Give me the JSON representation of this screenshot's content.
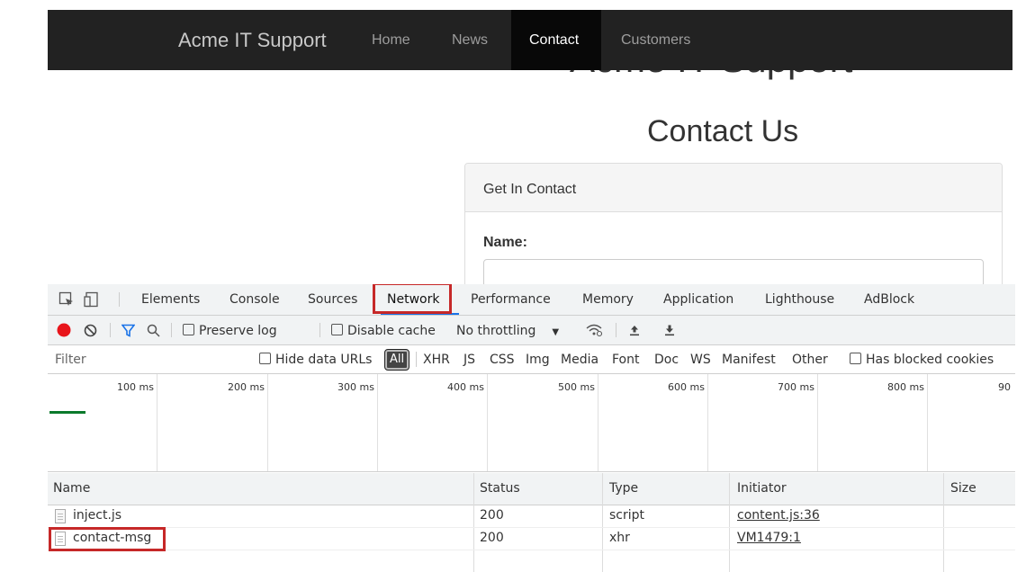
{
  "page": {
    "brand": "Acme IT Support",
    "nav": [
      {
        "label": "Home"
      },
      {
        "label": "News"
      },
      {
        "label": "Contact"
      },
      {
        "label": "Customers"
      }
    ],
    "hero_title": "Acme IT Support",
    "contact_title": "Contact Us",
    "panel_heading": "Get In Contact",
    "name_label": "Name:"
  },
  "devtools": {
    "tabs": [
      "Elements",
      "Console",
      "Sources",
      "Network",
      "Performance",
      "Memory",
      "Application",
      "Lighthouse",
      "AdBlock"
    ],
    "active_tab": "Network",
    "toolbar": {
      "preserve_log": "Preserve log",
      "disable_cache": "Disable cache",
      "throttling": "No throttling"
    },
    "filter": {
      "placeholder": "Filter",
      "hide_data_urls": "Hide data URLs",
      "all": "All",
      "types": [
        "XHR",
        "JS",
        "CSS",
        "Img",
        "Media",
        "Font",
        "Doc",
        "WS",
        "Manifest",
        "Other"
      ],
      "has_blocked_cookies": "Has blocked cookies"
    },
    "timeline_ticks": [
      "100 ms",
      "200 ms",
      "300 ms",
      "400 ms",
      "500 ms",
      "600 ms",
      "700 ms",
      "800 ms",
      "90"
    ],
    "columns": [
      "Name",
      "Status",
      "Type",
      "Initiator",
      "Size"
    ],
    "rows": [
      {
        "name": "inject.js",
        "status": "200",
        "type": "script",
        "initiator": "content.js:36"
      },
      {
        "name": "contact-msg",
        "status": "200",
        "type": "xhr",
        "initiator": "VM1479:1"
      }
    ],
    "record_color": "#e8151b",
    "accent": "#1a73e8",
    "highlight_color": "#c62828"
  }
}
